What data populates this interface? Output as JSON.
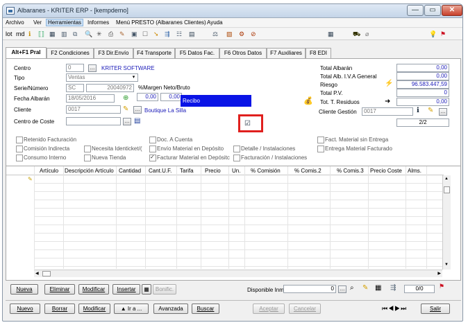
{
  "window": {
    "title": "Albaranes - KRITER ERP -  [kempdemo]",
    "minimize": "—",
    "maximize": "▭",
    "close": "✕"
  },
  "menu": [
    "Archivo",
    "Ver",
    "Herramientas",
    "Informes",
    "Menú PRESTO (Albaranes Clientes)",
    "Ayuda"
  ],
  "toolbar": {
    "lot": "lot",
    "md": "md"
  },
  "tabs": [
    "Alt+F1 Pral",
    "F2 Condiciones",
    "F3 Dir.Envío",
    "F4 Transporte",
    "F5 Datos Fac.",
    "F6 Otros Datos",
    "F7 Auxiliares",
    "F8 EDI"
  ],
  "form": {
    "centro_label": "Centro",
    "centro_value": "0",
    "centro_name": "KRITER SOFTWARE",
    "tipo_label": "Tipo",
    "tipo_value": "Ventas",
    "serie_label": "Serie/Número",
    "serie_value": "SC",
    "numero_value": "20040972",
    "fecha_label": "Fecha Albarán",
    "fecha_value": "18/05/2016",
    "cliente_label": "Cliente",
    "cliente_value": "0017",
    "cliente_name": "Boutique La Silla",
    "centro_coste_label": "Centro de Coste",
    "margen_label": "%Margen Neto/Bruto",
    "margen_neto": "0,00",
    "margen_bruto": "0,00",
    "recibo": "Recibo",
    "total_albaran_label": "Total Albarán",
    "total_albaran": "0,00",
    "total_iva_label": "Total Alb. I.V.A General",
    "total_iva": "0,00",
    "riesgo_label": "Riesgo",
    "riesgo": "96.583.447,59",
    "total_pv_label": "Total P.V.",
    "total_pv": "0",
    "residuos_label": "Tot. T. Residuos",
    "residuos": "0,00",
    "cliente_gestion_label": "Cliente Gestión",
    "cliente_gestion": "0017",
    "pagina": "2/2"
  },
  "checks": [
    {
      "label": "Retenido Facturación",
      "on": false
    },
    {
      "label": "Comisión Indirecta",
      "on": false
    },
    {
      "label": "Consumo Interno",
      "on": false
    },
    {
      "label": "Necesita Identicket/(",
      "on": false
    },
    {
      "label": "Nueva Tienda",
      "on": false
    },
    {
      "label": "Doc. A Cuenta",
      "on": false
    },
    {
      "label": "Envío Material en Depósito",
      "on": false
    },
    {
      "label": "Facturar Material en Depósitc",
      "on": true
    },
    {
      "label": "Detalle / Instalaciones",
      "on": false
    },
    {
      "label": "Facturación / Instalaciones",
      "on": false
    },
    {
      "label": "Fact. Material sin Entrega",
      "on": false
    },
    {
      "label": "Entrega Material Facturado",
      "on": false
    }
  ],
  "grid": {
    "columns": [
      "Artículo",
      "Descripción Artículo",
      "Cantidad",
      "Cant.U.F.",
      "Tarifa",
      "Precio",
      "Un.",
      "% Comisión",
      "% Comis.2",
      "% Comis.3",
      "Precio Coste",
      "Alms."
    ]
  },
  "lines_bar": {
    "nueva": "Nueva",
    "eliminar": "Eliminar",
    "modificar": "Modificar",
    "insertar": "Insertar",
    "bonific": "Bonific.",
    "disponible_label": "Disponible Inm",
    "disponible_value": "0",
    "counter": "0/0"
  },
  "bottom_bar": {
    "nuevo": "Nuevo",
    "borrar": "Borrar",
    "modificar": "Modificar",
    "ira": "▲ Ir a ...",
    "avanzada": "Avanzada",
    "buscar": "Buscar",
    "aceptar": "Aceptar",
    "cancelar": "Cancelar",
    "salir": "Salir"
  },
  "colors": {
    "recibo_bg": "#0a14e6",
    "highlight_border": "#e0201e",
    "link": "#1a1ab8"
  }
}
